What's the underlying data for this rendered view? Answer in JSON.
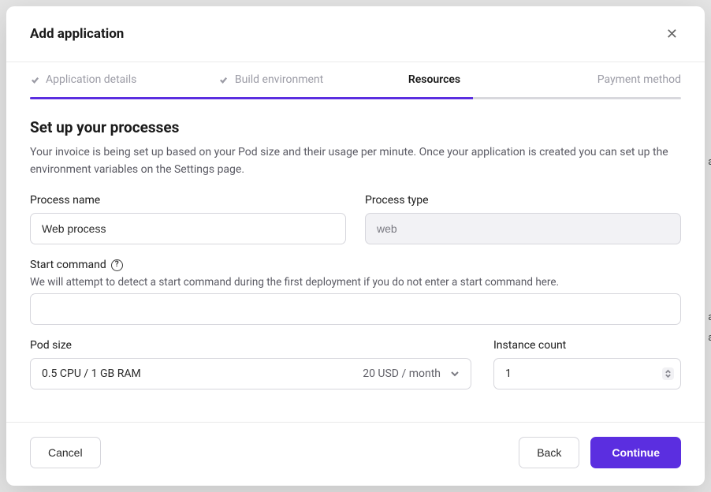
{
  "bg": {
    "t1": "as",
    "t2": "as",
    "t3": "as"
  },
  "modal": {
    "title": "Add application",
    "steps": {
      "items": [
        {
          "label": "Application details",
          "done": true
        },
        {
          "label": "Build environment",
          "done": true
        },
        {
          "label": "Resources",
          "active": true
        },
        {
          "label": "Payment method"
        }
      ]
    },
    "section": {
      "title": "Set up your processes",
      "desc": "Your invoice is being set up based on your Pod size and their usage per minute. Once your application is created you can set up the environment variables on the Settings page."
    },
    "fields": {
      "process_name": {
        "label": "Process name",
        "value": "Web process"
      },
      "process_type": {
        "label": "Process type",
        "value": "web"
      },
      "start_command": {
        "label": "Start command",
        "help": "We will attempt to detect a start command during the first deployment if you do not enter a start command here.",
        "value": ""
      },
      "pod_size": {
        "label": "Pod size",
        "value": "0.5 CPU / 1 GB RAM",
        "price": "20 USD / month"
      },
      "instance_count": {
        "label": "Instance count",
        "value": "1"
      }
    },
    "footer": {
      "cancel": "Cancel",
      "back": "Back",
      "continue": "Continue"
    }
  }
}
